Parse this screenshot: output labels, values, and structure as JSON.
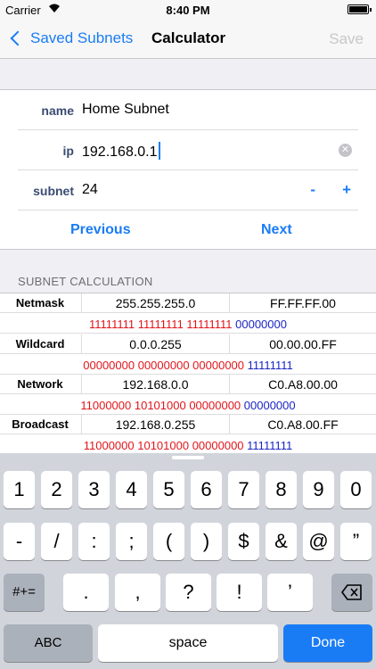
{
  "status_bar": {
    "carrier": "Carrier",
    "time": "8:40 PM"
  },
  "nav": {
    "back_label": "Saved Subnets",
    "title": "Calculator",
    "save_label": "Save"
  },
  "form": {
    "name_label": "name",
    "name_value": "Home Subnet",
    "ip_label": "ip",
    "ip_value": "192.168.0.1",
    "subnet_label": "subnet",
    "subnet_value": "24",
    "minus": "-",
    "plus": "+",
    "previous": "Previous",
    "next": "Next"
  },
  "calc": {
    "header": "SUBNET CALCULATION",
    "rows": [
      {
        "label": "Netmask",
        "decimal": "255.255.255.0",
        "hex": "FF.FF.FF.00",
        "bin_net": "11111111 11111111 11111111",
        "bin_host": "00000000"
      },
      {
        "label": "Wildcard",
        "decimal": "0.0.0.255",
        "hex": "00.00.00.FF",
        "bin_net": "00000000 00000000 00000000",
        "bin_host": "11111111"
      },
      {
        "label": "Network",
        "decimal": "192.168.0.0",
        "hex": "C0.A8.00.00",
        "bin_net": "11000000 10101000 00000000",
        "bin_host": "00000000"
      },
      {
        "label": "Broadcast",
        "decimal": "192.168.0.255",
        "hex": "C0.A8.00.FF",
        "bin_net": "11000000 10101000 00000000",
        "bin_host": "11111111"
      }
    ]
  },
  "keyboard": {
    "row1": [
      "1",
      "2",
      "3",
      "4",
      "5",
      "6",
      "7",
      "8",
      "9",
      "0"
    ],
    "row2": [
      "-",
      "/",
      ":",
      ";",
      "(",
      ")",
      "$",
      "&",
      "@",
      "”"
    ],
    "row3": [
      ".",
      ",",
      "?",
      "!",
      "’"
    ],
    "symbols_key": "#+=",
    "abc_key": "ABC",
    "space_key": "space",
    "done_key": "Done"
  },
  "colors": {
    "accent": "#1a7cf5",
    "binary_network": "#e0151b",
    "binary_host": "#1a24c4"
  }
}
